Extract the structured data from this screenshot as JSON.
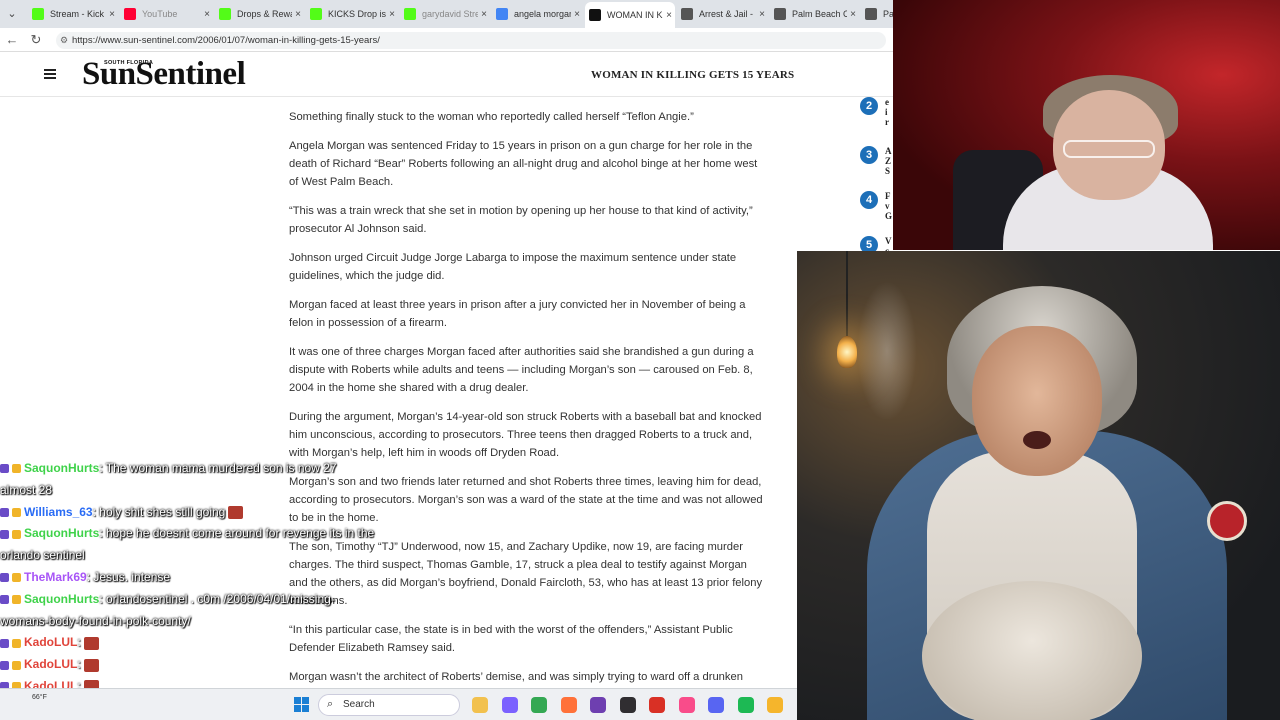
{
  "browser": {
    "tabs": [
      {
        "title": "Stream - Kick D",
        "favicon": "kick-icon",
        "color": "#53fc18",
        "dim": false
      },
      {
        "title": "YouTube",
        "favicon": "youtube-icon",
        "color": "#ff0033",
        "dim": true
      },
      {
        "title": "Drops & Rewar",
        "favicon": "kick-icon",
        "color": "#53fc18",
        "dim": false
      },
      {
        "title": "KICKS Drop is l",
        "favicon": "kick-icon",
        "color": "#53fc18",
        "dim": false
      },
      {
        "title": "garydavid Stre",
        "favicon": "kick-icon",
        "color": "#53fc18",
        "dim": true
      },
      {
        "title": "angela morgan",
        "favicon": "google-icon",
        "color": "#4285f4",
        "dim": false
      },
      {
        "title": "WOMAN IN KI",
        "favicon": "sun-sentinel-icon",
        "color": "#111111",
        "dim": false
      },
      {
        "title": "Arrest & Jail - F",
        "favicon": "star-icon",
        "color": "#555555",
        "dim": false
      },
      {
        "title": "Palm Beach Co",
        "favicon": "star-icon",
        "color": "#555555",
        "dim": false
      },
      {
        "title": "Palm",
        "favicon": "star-icon",
        "color": "#555555",
        "dim": false
      }
    ],
    "url": "https://www.sun-sentinel.com/2006/01/07/woman-in-killing-gets-15-years/"
  },
  "site": {
    "logo_small": "SOUTH FLORIDA",
    "logo": "SunSentinel",
    "headline": "WOMAN IN KILLING GETS 15 YEARS"
  },
  "article": {
    "paragraphs": [
      "Something finally stuck to the woman who reportedly called herself “Teflon Angie.”",
      "Angela Morgan was sentenced Friday to 15 years in prison on a gun charge for her role in the death of Richard “Bear” Roberts following an all-night drug and alcohol binge at her home west of West Palm Beach.",
      "“This was a train wreck that she set in motion by opening up her house to that kind of activity,” prosecutor Al Johnson said.",
      "Johnson urged Circuit Judge Jorge Labarga to impose the maximum sentence under state guidelines, which the judge did.",
      "Morgan faced at least three years in prison after a jury convicted her in November of being a felon in possession of a firearm.",
      "It was one of three charges Morgan faced after authorities said she brandished a gun during a dispute with Roberts while adults and teens — including Morgan’s son — caroused on Feb. 8, 2004 in the home she shared with a drug dealer.",
      "During the argument, Morgan’s 14-year-old son struck Roberts with a baseball bat and knocked him unconscious, according to prosecutors. Three teens then dragged Roberts to a truck and, with Morgan’s help, left him in woods off Dryden Road.",
      "Morgan’s son and two friends later returned and shot Roberts three times, leaving him for dead, according to prosecutors. Morgan’s son was a ward of the state at the time and was not allowed to be in the home.",
      "The son, Timothy “TJ” Underwood, now 15, and Zachary Updike, now 19, are facing murder charges. The third suspect, Thomas Gamble, 17, struck a plea deal to testify against Morgan and the others, as did Morgan’s boyfriend, Donald Faircloth, 53, who has at least 13 prior felony convictions.",
      "“In this particular case, the state is in bed with the worst of the offenders,” Assistant Public Defender Elizabeth Ramsey said.",
      "Morgan wasn’t the architect of Roberts’ demise, and was simply trying to ward off a drunken"
    ],
    "trending": [
      {
        "num": "2",
        "text": "e\ni\nr"
      },
      {
        "num": "3",
        "text": "A\nZ\nS"
      },
      {
        "num": "4",
        "text": "F\nv\nG"
      },
      {
        "num": "5",
        "text": "V\nc"
      }
    ]
  },
  "chat": [
    {
      "user": "SaquonHurts",
      "color": "#3fd24a",
      "message": ": The woman mama murdered son is now 27",
      "cont": "almost 28",
      "emote": false
    },
    {
      "user": "Williams_63",
      "color": "#2a6cf5",
      "message": ": holy shit shes still going",
      "cont": "",
      "emote": true
    },
    {
      "user": "SaquonHurts",
      "color": "#3fd24a",
      "message": ": hope he doesnt come around for revenge its in the",
      "cont": "orlando sentinel",
      "emote": false
    },
    {
      "user": "TheMark69",
      "color": "#a855f7",
      "message": ": Jesus. intense",
      "cont": "",
      "emote": false
    },
    {
      "user": "SaquonHurts",
      "color": "#3fd24a",
      "message": ": orlandosentinel . c0m /2006/04/01/missing-",
      "cont": "womans-body-found-in-polk-county/",
      "emote": false
    },
    {
      "user": "KadoLUL",
      "color": "#e0443a",
      "message": ":",
      "cont": "",
      "emote": true
    },
    {
      "user": "KadoLUL",
      "color": "#e0443a",
      "message": ":",
      "cont": "",
      "emote": true
    },
    {
      "user": "KadoLUL",
      "color": "#e0443a",
      "message": ":",
      "cont": "",
      "emote": true
    }
  ],
  "taskbar": {
    "weather": "66°F",
    "search_label": "Search",
    "apps": [
      {
        "name": "file-explorer-icon",
        "color": "#f2c14e"
      },
      {
        "name": "copilot-icon",
        "color": "#7b61ff"
      },
      {
        "name": "chrome-icon",
        "color": "#34a853"
      },
      {
        "name": "firefox-icon",
        "color": "#ff7139"
      },
      {
        "name": "app-purple-icon",
        "color": "#6e3fb0"
      },
      {
        "name": "obs-icon",
        "color": "#302e31"
      },
      {
        "name": "app-red-icon",
        "color": "#d93025"
      },
      {
        "name": "itunes-icon",
        "color": "#f94c8a"
      },
      {
        "name": "discord-icon",
        "color": "#5865f2"
      },
      {
        "name": "spotify-icon",
        "color": "#1db954"
      },
      {
        "name": "folder-icon",
        "color": "#f5b52c"
      }
    ]
  }
}
